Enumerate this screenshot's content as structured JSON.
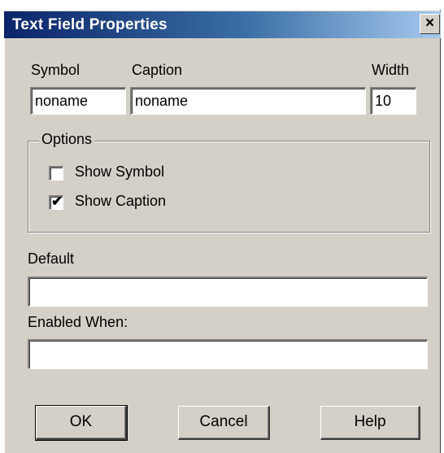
{
  "window": {
    "title": "Text Field Properties",
    "close_glyph": "×"
  },
  "fields": {
    "symbol_label": "Symbol",
    "symbol_value": "noname",
    "caption_label": "Caption",
    "caption_value": "noname",
    "width_label": "Width",
    "width_value": "10"
  },
  "options": {
    "group_label": "Options",
    "show_symbol_label": "Show Symbol",
    "show_symbol_checked": false,
    "show_caption_label": "Show Caption",
    "show_caption_checked": true
  },
  "default_field": {
    "label": "Default",
    "value": ""
  },
  "enabled_when": {
    "label": "Enabled When:",
    "value": ""
  },
  "buttons": {
    "ok": "OK",
    "cancel": "Cancel",
    "help": "Help"
  }
}
